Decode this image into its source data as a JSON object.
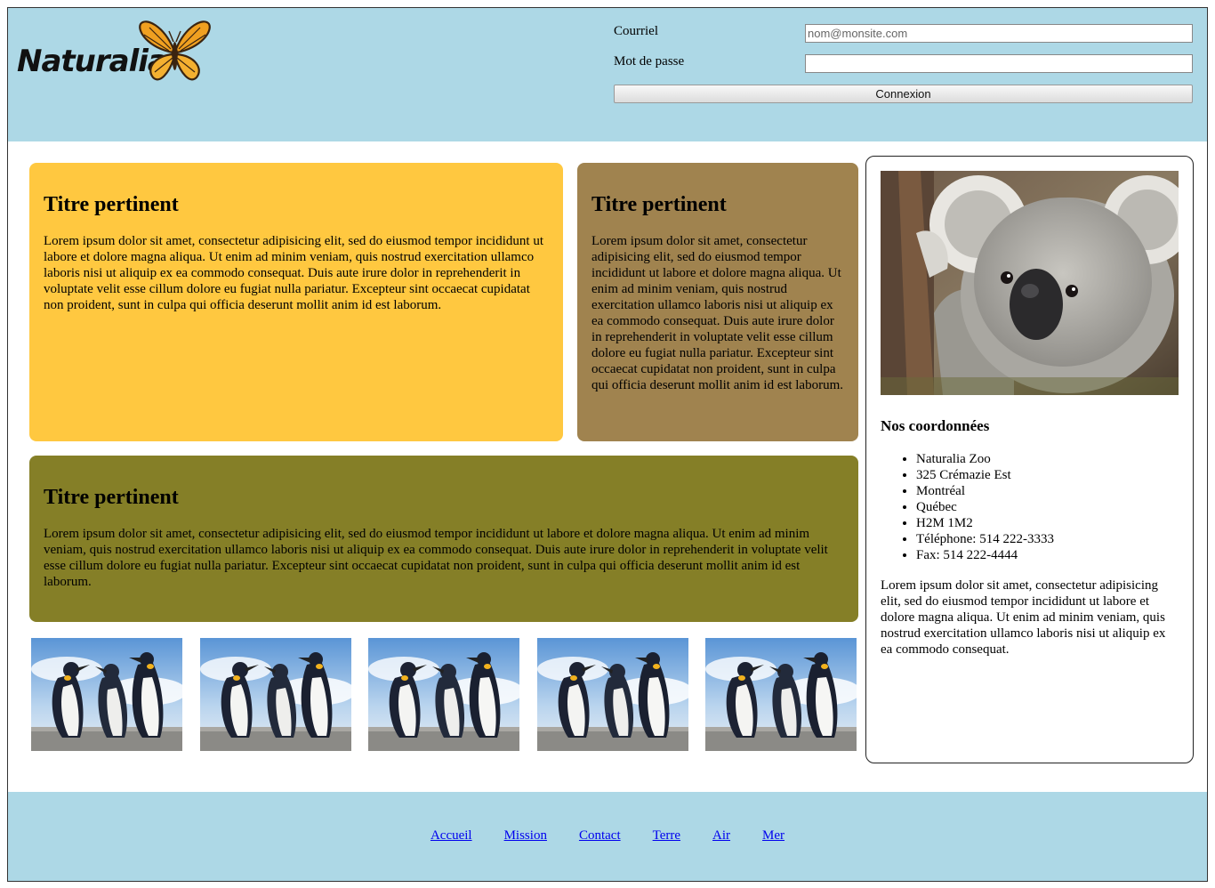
{
  "brand": {
    "name": "Naturalia"
  },
  "login": {
    "email_label": "Courriel",
    "email_placeholder": "nom@monsite.com",
    "password_label": "Mot de passe",
    "password_value": "",
    "submit_label": "Connexion"
  },
  "cards": [
    {
      "title": "Titre pertinent",
      "body": "Lorem ipsum dolor sit amet, consectetur adipisicing elit, sed do eiusmod tempor incididunt ut labore et dolore magna aliqua. Ut enim ad minim veniam, quis nostrud exercitation ullamco laboris nisi ut aliquip ex ea commodo consequat. Duis aute irure dolor in reprehenderit in voluptate velit esse cillum dolore eu fugiat nulla pariatur. Excepteur sint occaecat cupidatat non proident, sunt in culpa qui officia deserunt mollit anim id est laborum.",
      "color": "#ffc840"
    },
    {
      "title": "Titre pertinent",
      "body": "Lorem ipsum dolor sit amet, consectetur adipisicing elit, sed do eiusmod tempor incididunt ut labore et dolore magna aliqua. Ut enim ad minim veniam, quis nostrud exercitation ullamco laboris nisi ut aliquip ex ea commodo consequat. Duis aute irure dolor in reprehenderit in voluptate velit esse cillum dolore eu fugiat nulla pariatur. Excepteur sint occaecat cupidatat non proident, sunt in culpa qui officia deserunt mollit anim id est laborum.",
      "color": "#a0834f"
    },
    {
      "title": "Titre pertinent",
      "body": "Lorem ipsum dolor sit amet, consectetur adipisicing elit, sed do eiusmod tempor incididunt ut labore et dolore magna aliqua. Ut enim ad minim veniam, quis nostrud exercitation ullamco laboris nisi ut aliquip ex ea commodo consequat. Duis aute irure dolor in reprehenderit in voluptate velit esse cillum dolore eu fugiat nulla pariatur. Excepteur sint occaecat cupidatat non proident, sunt in culpa qui officia deserunt mollit anim id est laborum.",
      "color": "#857f27"
    }
  ],
  "sidebar": {
    "title": "Nos coordonnées",
    "contacts": [
      "Naturalia Zoo",
      "325 Crémazie Est",
      "Montréal",
      "Québec",
      "H2M 1M2",
      "Téléphone: 514 222-3333",
      "Fax: 514 222-4444"
    ],
    "body": "Lorem ipsum dolor sit amet, consectetur adipisicing elit, sed do eiusmod tempor incididunt ut labore et dolore magna aliqua. Ut enim ad minim veniam, quis nostrud exercitation ullamco laboris nisi ut aliquip ex ea commodo consequat."
  },
  "gallery": {
    "image_count": 5,
    "subject": "penguin-photo"
  },
  "footer": {
    "links": [
      "Accueil",
      "Mission",
      "Contact",
      "Terre",
      "Air",
      "Mer"
    ]
  },
  "colors": {
    "header_bg": "#add8e6",
    "link": "#0000ee"
  }
}
